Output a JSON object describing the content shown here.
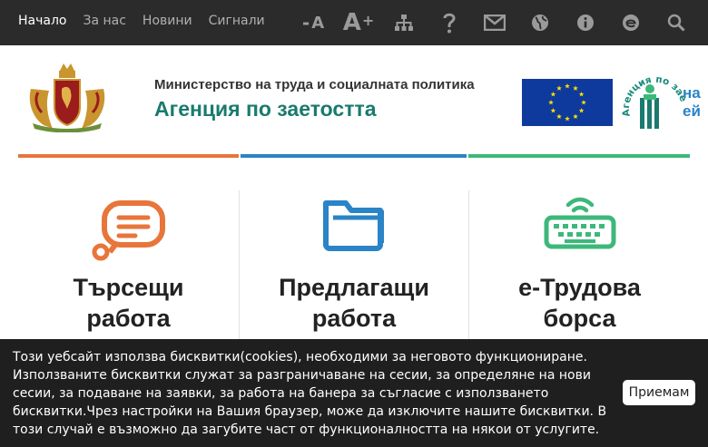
{
  "nav": {
    "items": [
      {
        "label": "Начало",
        "active": true
      },
      {
        "label": "За нас",
        "active": false
      },
      {
        "label": "Новини",
        "active": false
      },
      {
        "label": "Сигнали",
        "active": false
      }
    ]
  },
  "tools": {
    "font_decrease": {
      "sign": "-",
      "letter": "A"
    },
    "font_increase": {
      "letter": "A",
      "sign": "+"
    },
    "icons": [
      "font-decrease-icon",
      "font-increase-icon",
      "sitemap-icon",
      "help-icon",
      "mail-icon",
      "globe-icon",
      "info-icon",
      "e-services-icon",
      "search-icon"
    ]
  },
  "header": {
    "ministry": "Министерство на труда и социалната политика",
    "agency": "Агенция по заетостта",
    "logo_text": "Агенция по заетостта",
    "logo_side": "на\nей"
  },
  "colors": {
    "orange": "#e8753a",
    "blue": "#2a84c6",
    "green": "#3db87a",
    "teal": "#1a7a6e",
    "dark": "#2b2b2b"
  },
  "columns": [
    {
      "line1": "Търсещи",
      "line2": "работа",
      "icon": "chat-bubble-icon"
    },
    {
      "line1": "Предлагащи",
      "line2": "работа",
      "icon": "folder-icon"
    },
    {
      "line1": "е-Трудова",
      "line2": "борса",
      "icon": "keyboard-icon"
    }
  ],
  "cookie": {
    "text": "Този уебсайт използва бисквитки(cookies), необходими за неговото функциониране. Използваните бисквитки служат за разграничаване на сесии, за определяне на нови сесии, за подаване на заявки, за работа на банера за съгласие с използването бисквитки.Чрез настройки на Вашия браузер, може да изключите нашите бисквитки. В този случай е възможно да загубите част от функционалността на някои от услугите.",
    "accept_label": "Приемам"
  }
}
